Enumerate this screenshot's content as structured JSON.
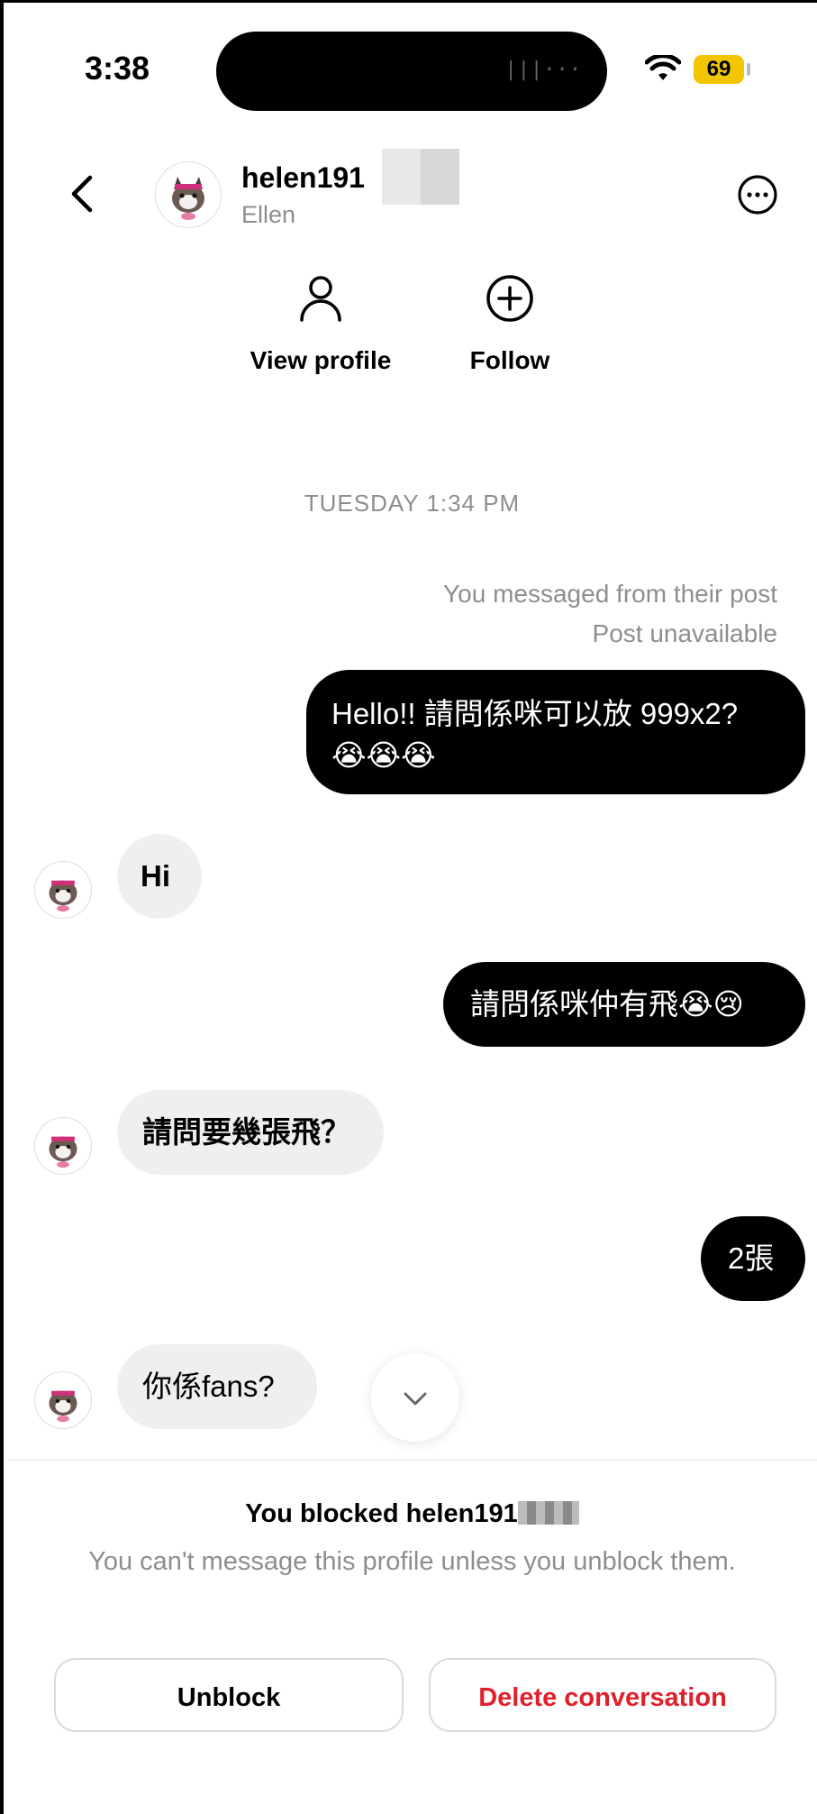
{
  "status_bar": {
    "time": "3:38",
    "battery": "69"
  },
  "header": {
    "username": "helen191",
    "display_name": "Ellen"
  },
  "actions": {
    "view_profile": "View profile",
    "follow": "Follow"
  },
  "thread": {
    "timestamp": "TUESDAY 1:34 PM",
    "context_line1": "You messaged from their post",
    "context_line2": "Post unavailable",
    "messages": [
      {
        "from": "me",
        "text": "Hello!! 請問係咪可以放 999x2?",
        "emoji": "😭😭😭"
      },
      {
        "from": "them",
        "text": "Hi"
      },
      {
        "from": "me",
        "text": "請問係咪仲有飛😭😢"
      },
      {
        "from": "them",
        "text": "請問要幾張飛？"
      },
      {
        "from": "me",
        "text": "2張"
      },
      {
        "from": "them",
        "text": "你係fans?"
      }
    ]
  },
  "blocked_panel": {
    "title": "You blocked helen191",
    "subtitle": "You can't message this profile unless you unblock them.",
    "unblock_label": "Unblock",
    "delete_label": "Delete conversation"
  },
  "colors": {
    "outgoing_bubble": "#000000",
    "incoming_bubble": "#efefef",
    "danger": "#e0202a",
    "battery": "#f2c500"
  }
}
